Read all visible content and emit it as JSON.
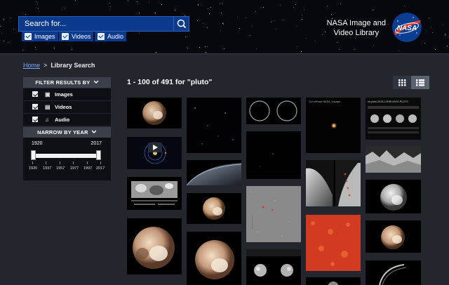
{
  "header": {
    "search_placeholder": "Search for...",
    "media_filters": [
      {
        "label": "Images",
        "checked": true
      },
      {
        "label": "Videos",
        "checked": true
      },
      {
        "label": "Audio",
        "checked": true
      }
    ],
    "brand_line1": "NASA Image and",
    "brand_line2": "Video Library",
    "logo_text": "NASA"
  },
  "breadcrumb": {
    "home": "Home",
    "separator": ">",
    "current": "Library Search"
  },
  "filters": {
    "title": "FILTER RESULTS BY",
    "items": [
      {
        "label": "Images",
        "icon": "image-icon",
        "checked": true
      },
      {
        "label": "Videos",
        "icon": "film-icon",
        "checked": true
      },
      {
        "label": "Audio",
        "icon": "music-icon",
        "checked": true
      }
    ]
  },
  "year": {
    "title": "NARROW BY YEAR",
    "start": "1920",
    "end": "2017",
    "ticks": [
      "1920",
      "1937",
      "1957",
      "1977",
      "1997",
      "2017"
    ]
  },
  "results": {
    "summary": "1 - 100 of 491 for \"pluto\""
  },
  "view_toggle": {
    "grid_icon": "grid-icon",
    "list_icon": "list-icon",
    "active": "list"
  },
  "thumbnail_texts": {
    "t4_caption": "Our ultimate NASA_Voyager",
    "t5_caption": "nh-pluto-2015-LORRI-MVIC-PLUTO"
  },
  "colors": {
    "accent": "#0b3a8c",
    "link": "#7aa7ff",
    "background": "#23262d"
  }
}
